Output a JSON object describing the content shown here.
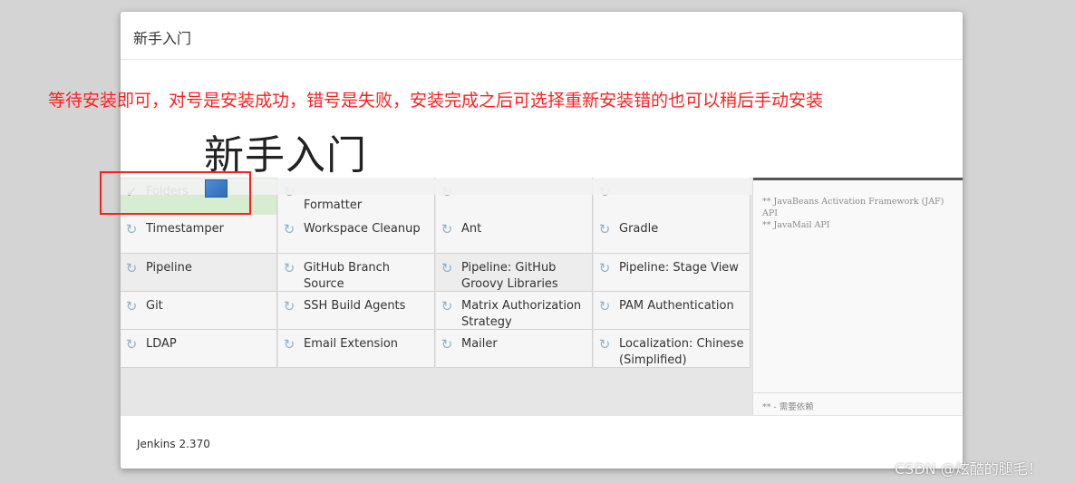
{
  "modal": {
    "title": "新手入门",
    "heading": "新手入门",
    "footer_version": "Jenkins 2.370"
  },
  "annotation": {
    "text": "等待安装即可，对号是安装成功，错号是失败，安装完成之后可选择重新安装错的也可以稍后手动安装"
  },
  "plugins": [
    {
      "label": "Folders",
      "status": "done",
      "icon": "check-icon"
    },
    {
      "label": "Formatter",
      "status": "pending",
      "icon": "refresh-icon"
    },
    {
      "label": "",
      "status": "pending",
      "icon": "refresh-icon"
    },
    {
      "label": "",
      "status": "pending",
      "icon": "refresh-icon"
    },
    {
      "label": "Timestamper",
      "status": "pending",
      "icon": "refresh-icon"
    },
    {
      "label": "Workspace Cleanup",
      "status": "pending",
      "icon": "refresh-icon"
    },
    {
      "label": "Ant",
      "status": "pending",
      "icon": "refresh-icon"
    },
    {
      "label": "Gradle",
      "status": "pending",
      "icon": "refresh-icon"
    },
    {
      "label": "Pipeline",
      "status": "installing",
      "icon": "refresh-icon"
    },
    {
      "label": "GitHub Branch Source",
      "status": "pending",
      "icon": "refresh-icon"
    },
    {
      "label": "Pipeline: GitHub Groovy Libraries",
      "status": "installing",
      "icon": "refresh-icon"
    },
    {
      "label": "Pipeline: Stage View",
      "status": "pending",
      "icon": "refresh-icon"
    },
    {
      "label": "Git",
      "status": "pending",
      "icon": "refresh-icon"
    },
    {
      "label": "SSH Build Agents",
      "status": "pending",
      "icon": "refresh-icon"
    },
    {
      "label": "Matrix Authorization Strategy",
      "status": "pending",
      "icon": "refresh-icon"
    },
    {
      "label": "PAM Authentication",
      "status": "pending",
      "icon": "refresh-icon"
    },
    {
      "label": "LDAP",
      "status": "pending",
      "icon": "refresh-icon"
    },
    {
      "label": "Email Extension",
      "status": "pending",
      "icon": "refresh-icon"
    },
    {
      "label": "Mailer",
      "status": "pending",
      "icon": "refresh-icon"
    },
    {
      "label": "Localization: Chinese (Simplified)",
      "status": "pending",
      "icon": "refresh-icon"
    }
  ],
  "console": {
    "lines": "** JavaBeans Activation Framework (JAF)\nAPI\n** JavaMail API",
    "footer": "** - 需要依赖"
  },
  "watermark": "CSDN @炫酷的腿毛！",
  "colors": {
    "annotation_red": "#ff2020",
    "done_green": "#d6edd1",
    "check_green": "#2c7a2c"
  }
}
